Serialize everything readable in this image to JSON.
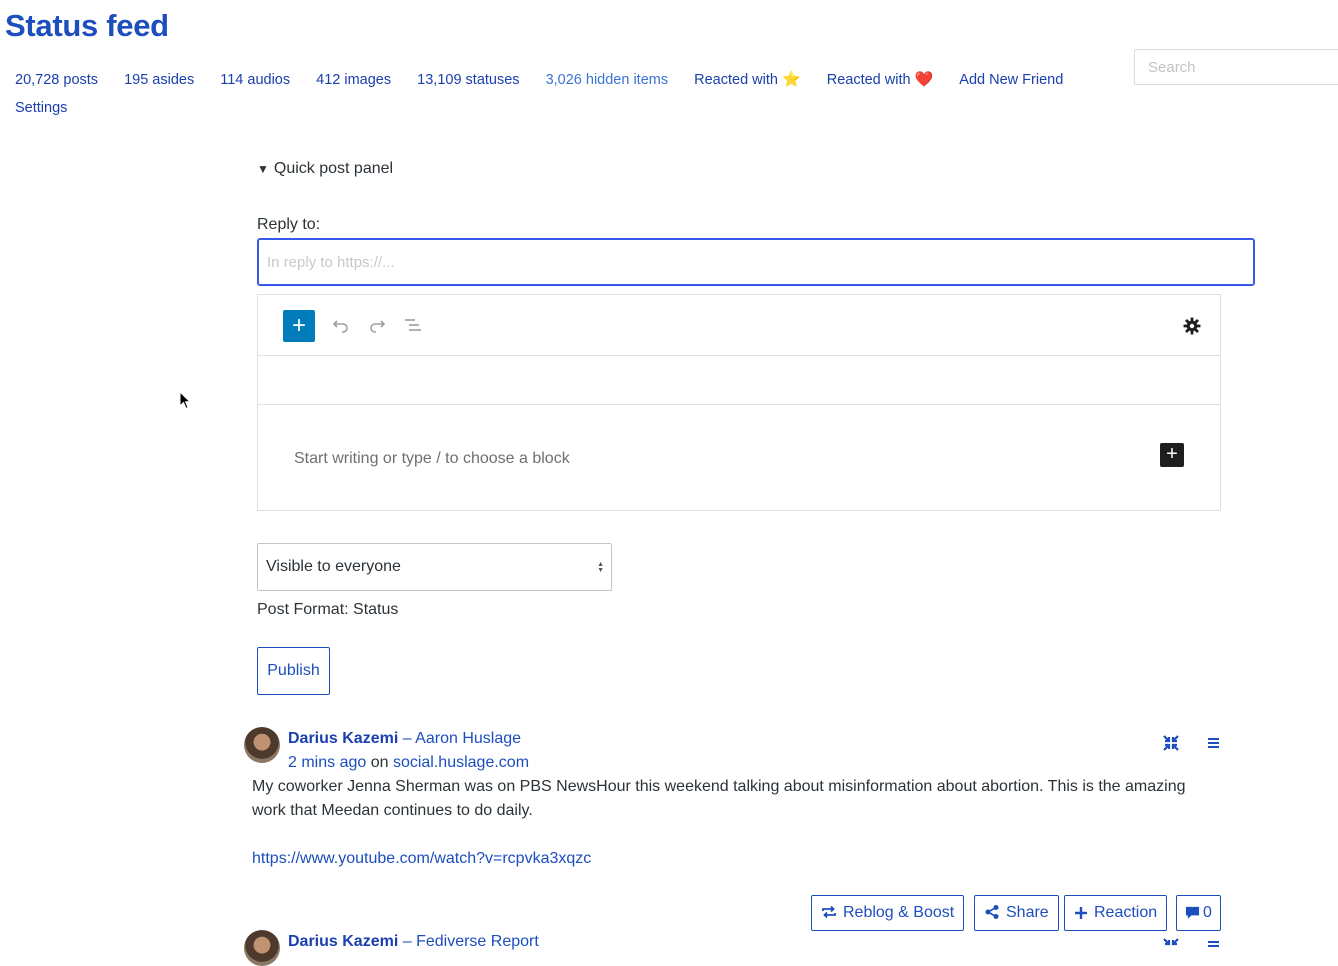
{
  "header": {
    "title": "Status feed",
    "search_placeholder": "Search"
  },
  "nav": {
    "posts": "20,728 posts",
    "asides": "195 asides",
    "audios": "114 audios",
    "images": "412 images",
    "statuses": "13,109 statuses",
    "hidden": "3,026 hidden items",
    "reacted_star": "Reacted with",
    "reacted_star_emoji": "⭐",
    "reacted_heart": "Reacted with",
    "reacted_heart_emoji": "❤️",
    "add_friend": "Add New Friend",
    "settings": "Settings"
  },
  "quick_post": {
    "toggle_label": "Quick post panel",
    "reply_label": "Reply to:",
    "reply_placeholder": "In reply to https://...",
    "editor_placeholder": "Start writing or type / to choose a block",
    "visibility_value": "Visible to everyone",
    "post_format": "Post Format: Status",
    "publish_label": "Publish"
  },
  "posts": [
    {
      "author": "Darius Kazemi",
      "separator": " – ",
      "source": "Aaron Huslage",
      "time": "2 mins ago",
      "on": " on ",
      "site": "social.huslage.com",
      "text": "My coworker Jenna Sherman was on PBS NewsHour this weekend talking about misinformation about abortion. This is the amazing work that Meedan continues to do daily.",
      "link": "https://www.youtube.com/watch?v=rcpvka3xqzc",
      "actions": {
        "reblog": "Reblog & Boost",
        "share": "Share",
        "reaction": "Reaction",
        "comments": "0"
      }
    },
    {
      "author": "Darius Kazemi",
      "separator": " – ",
      "source": "Fediverse Report"
    }
  ],
  "colors": {
    "link": "#1d4ebd",
    "accent": "#007cba",
    "focus": "#3858e9"
  }
}
